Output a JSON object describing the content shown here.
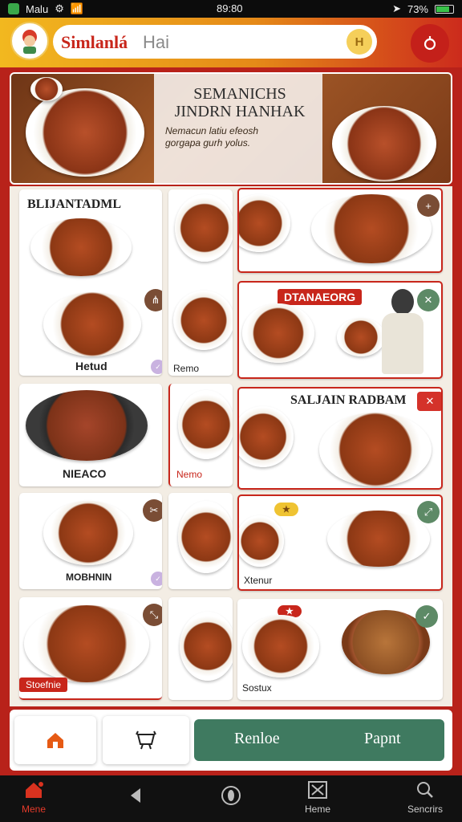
{
  "status_bar": {
    "carrier": "Malu",
    "time": "89:80",
    "battery": "73%"
  },
  "header": {
    "title": "Simlanlá",
    "search_placeholder": "Hai",
    "search_action": "H"
  },
  "hero": {
    "headline_1": "SEMANICHS",
    "headline_2": "JINDRN HANHAK",
    "subtext_1": "Nemacun latiu efeosh",
    "subtext_2": "gorgapa gurh yolus."
  },
  "cards": {
    "c1_heading": "BLIJANTADML",
    "c1_label": "Hetud",
    "c2_label": "Remo",
    "c3_tag": "DTANAEORG",
    "c4_label": "NIEACO",
    "c5_tag": "Nemo",
    "c6_heading": "SALJAIN RADBAM",
    "c7_label": "MOBHNIN",
    "c8_label": "Xtenur",
    "c9_tag": "Stoefnie",
    "c10_label": "Sostux",
    "c3_chip": "✕",
    "c6_chip": "✕"
  },
  "action_bar": {
    "primary_left": "Renloe",
    "primary_right": "Papnt"
  },
  "bottom_nav": {
    "home": "Mene",
    "names": "Heme",
    "search": "Sencrirs"
  },
  "colors": {
    "brand_red": "#c8261b",
    "brand_gold": "#f2b81f",
    "accent_green": "#3f7a60"
  }
}
